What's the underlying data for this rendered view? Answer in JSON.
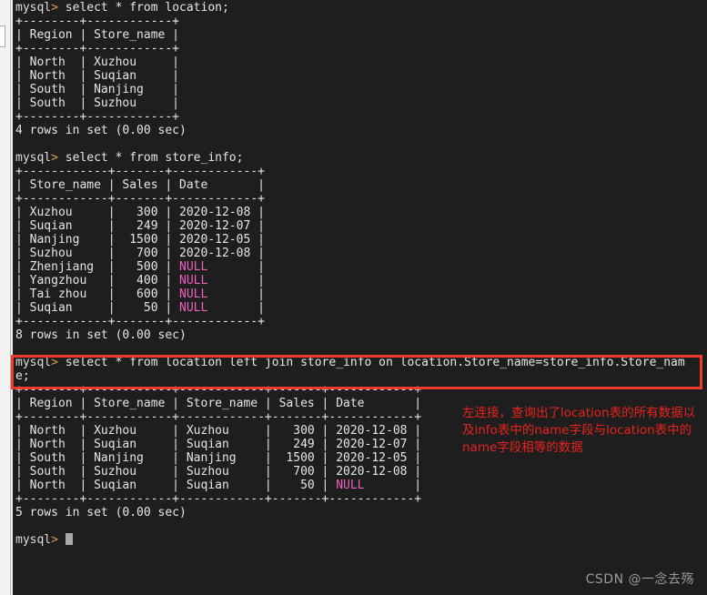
{
  "terminal": {
    "prompt": "mysql>",
    "lines": [
      {
        "type": "prompt",
        "text": " select * from location;"
      },
      {
        "type": "out",
        "text": "+--------+------------+"
      },
      {
        "type": "out",
        "text": "| Region | Store_name |"
      },
      {
        "type": "out",
        "text": "+--------+------------+"
      },
      {
        "type": "out",
        "text": "| North  | Xuzhou     |"
      },
      {
        "type": "out",
        "text": "| North  | Suqian     |"
      },
      {
        "type": "out",
        "text": "| South  | Nanjing    |"
      },
      {
        "type": "out",
        "text": "| South  | Suzhou     |"
      },
      {
        "type": "out",
        "text": "+--------+------------+"
      },
      {
        "type": "out",
        "text": "4 rows in set (0.00 sec)"
      },
      {
        "type": "blank",
        "text": ""
      },
      {
        "type": "prompt",
        "text": " select * from store_info;"
      },
      {
        "type": "out",
        "text": "+------------+-------+------------+"
      },
      {
        "type": "out",
        "text": "| Store_name | Sales | Date       |"
      },
      {
        "type": "out",
        "text": "+------------+-------+------------+"
      },
      {
        "type": "out",
        "text": "| Xuzhou     |   300 | 2020-12-08 |"
      },
      {
        "type": "out",
        "text": "| Suqian     |   249 | 2020-12-07 |"
      },
      {
        "type": "out",
        "text": "| Nanjing    |  1500 | 2020-12-05 |"
      },
      {
        "type": "out",
        "text": "| Suzhou     |   700 | 2020-12-08 |"
      },
      {
        "type": "null",
        "pre": "| Zhenjiang  |   500 | ",
        "null": "NULL",
        "post": "       |"
      },
      {
        "type": "null",
        "pre": "| Yangzhou   |   400 | ",
        "null": "NULL",
        "post": "       |"
      },
      {
        "type": "null",
        "pre": "| Tai zhou   |   600 | ",
        "null": "NULL",
        "post": "       |"
      },
      {
        "type": "null",
        "pre": "| Suqian     |    50 | ",
        "null": "NULL",
        "post": "       |"
      },
      {
        "type": "out",
        "text": "+------------+-------+------------+"
      },
      {
        "type": "out",
        "text": "8 rows in set (0.00 sec)"
      },
      {
        "type": "blank",
        "text": ""
      },
      {
        "type": "prompt",
        "text": " select * from location left join store_info on location.Store_name=store_info.Store_nam"
      },
      {
        "type": "out",
        "text": "e;"
      },
      {
        "type": "out",
        "text": "+--------+------------+------------+-------+------------+"
      },
      {
        "type": "out",
        "text": "| Region | Store_name | Store_name | Sales | Date       |"
      },
      {
        "type": "out",
        "text": "+--------+------------+------------+-------+------------+"
      },
      {
        "type": "out",
        "text": "| North  | Xuzhou     | Xuzhou     |   300 | 2020-12-08 |"
      },
      {
        "type": "out",
        "text": "| North  | Suqian     | Suqian     |   249 | 2020-12-07 |"
      },
      {
        "type": "out",
        "text": "| South  | Nanjing    | Nanjing    |  1500 | 2020-12-05 |"
      },
      {
        "type": "out",
        "text": "| South  | Suzhou     | Suzhou     |   700 | 2020-12-08 |"
      },
      {
        "type": "null",
        "pre": "| North  | Suqian     | Suqian     |    50 | ",
        "null": "NULL",
        "post": "       |"
      },
      {
        "type": "out",
        "text": "+--------+------------+------------+-------+------------+"
      },
      {
        "type": "out",
        "text": "5 rows in set (0.00 sec)"
      },
      {
        "type": "blank",
        "text": ""
      },
      {
        "type": "cursor",
        "text": " "
      }
    ]
  },
  "annotation": {
    "text": "左连接，查询出了location表的所有数据以及info表中的name字段与location表中的name字段相等的数据",
    "color": "#e8231f"
  },
  "highlight": {
    "color": "#ef3b2c"
  },
  "watermark": {
    "text": "CSDN @一念去殇"
  },
  "colors": {
    "background": "#1e1e1e",
    "text": "#e6e6e6",
    "null": "#ef5fc0",
    "gutter": "#f2f2f2"
  }
}
